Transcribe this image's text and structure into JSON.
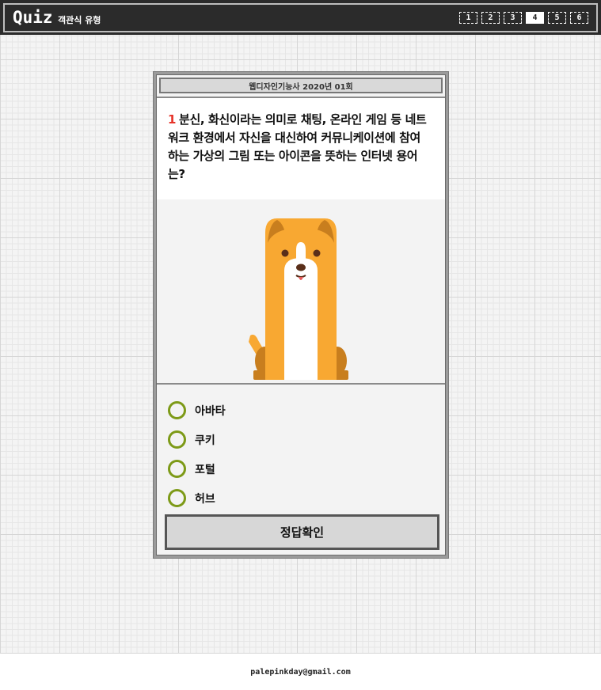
{
  "header": {
    "logo": "Quiz",
    "subtitle": "객관식 유형",
    "pages": [
      "1",
      "2",
      "3",
      "4",
      "5",
      "6"
    ],
    "active_page": "4"
  },
  "quiz": {
    "source": "웹디자인기능사 2020년 01회",
    "number": "1",
    "question": "분신, 화신이라는 의미로 채팅, 온라인 게임 등 네트워크 환경에서 자신을 대신하여 커뮤니케이션에 참여하는 가상의 그림 또는 아이콘을 뜻하는 인터넷 용어는?",
    "image_icon": "dog-illustration-icon",
    "options": [
      {
        "label": "아바타"
      },
      {
        "label": "쿠키"
      },
      {
        "label": "포털"
      },
      {
        "label": "허브"
      }
    ],
    "submit_label": "정답확인"
  },
  "footer": {
    "email": "palepinkday@gmail.com"
  },
  "colors": {
    "header_bg": "#2b2b2b",
    "radio_border": "#7d9a17",
    "question_number": "#e63329",
    "dog_orange": "#f8a832",
    "dog_dark": "#c87e1e"
  }
}
